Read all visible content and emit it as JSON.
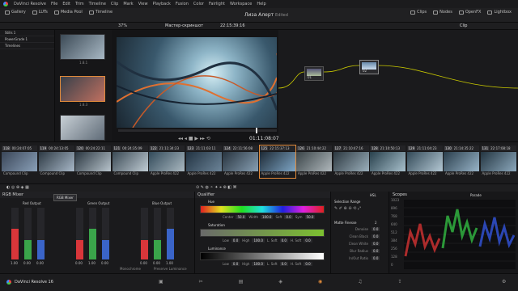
{
  "app": {
    "name": "DaVinci Resolve 16"
  },
  "menu": [
    "DaVinci Resolve",
    "File",
    "Edit",
    "Trim",
    "Timeline",
    "Clip",
    "Mark",
    "View",
    "Playback",
    "Fusion",
    "Color",
    "Fairlight",
    "Workspace",
    "Help"
  ],
  "toolbar": {
    "left": [
      {
        "label": "Gallery",
        "icon": "gallery-icon"
      },
      {
        "label": "LUTs",
        "icon": "luts-icon"
      },
      {
        "label": "Media Pool",
        "icon": "media-pool-icon"
      },
      {
        "label": "Timeline",
        "icon": "timeline-icon"
      }
    ],
    "project_title": "Лиза Алерт",
    "project_status": "Edited",
    "right": [
      {
        "label": "Clips",
        "icon": "clips-icon"
      },
      {
        "label": "Nodes",
        "icon": "nodes-icon"
      },
      {
        "label": "OpenFX",
        "icon": "openfx-icon"
      },
      {
        "label": "Lightbox",
        "icon": "lightbox-icon"
      }
    ]
  },
  "viewer": {
    "zoom": "37%",
    "timeline_name": "Мастер-скриншот",
    "timecode": "22:15:39:16",
    "playhead_tc": "01:11:08:07"
  },
  "nodes": {
    "mode": "Clip",
    "labels": [
      "01",
      "02"
    ]
  },
  "stills": [
    "Stills 1",
    "PowerGrade 1",
    "Timelines"
  ],
  "gallery": [
    "1.8.1",
    "1.8.3",
    "1.11.1"
  ],
  "clips": [
    {
      "num": "118",
      "tc": "00:24:07:05",
      "label": "Compound Clip",
      "c1": "#3a4658",
      "c2": "#8aa0b8"
    },
    {
      "num": "119",
      "tc": "00:24:13:05",
      "label": "Compound Clip",
      "c1": "#2e3a44",
      "c2": "#a8b8c8"
    },
    {
      "num": "120",
      "tc": "00:24:22:11",
      "label": "Compound Clip",
      "c1": "#2a3640",
      "c2": "#b8c4cc"
    },
    {
      "num": "121",
      "tc": "00:24:35:09",
      "label": "Compound Clip",
      "c1": "#3b4a55",
      "c2": "#c0ccd4"
    },
    {
      "num": "122",
      "tc": "21:11:34:23",
      "label": "Apple ProRes 422",
      "c1": "#324a5a",
      "c2": "#aab8c0"
    },
    {
      "num": "123",
      "tc": "21:11:03:11",
      "label": "Apple ProRes 422",
      "c1": "#223342",
      "c2": "#6c8498"
    },
    {
      "num": "124",
      "tc": "22:11:56:08",
      "label": "Apple ProRes 422",
      "c1": "#27333e",
      "c2": "#88a0b4"
    },
    {
      "num": "125",
      "tc": "22:15:37:13",
      "label": "Apple ProRes 422",
      "c1": "#1e2a35",
      "c2": "#7ea6c6",
      "active": true
    },
    {
      "num": "126",
      "tc": "21:10:44:22",
      "label": "Apple ProRes 422",
      "c1": "#3a4448",
      "c2": "#b0b8bc"
    },
    {
      "num": "127",
      "tc": "21:10:47:16",
      "label": "Apple ProRes 422",
      "c1": "#2c3840",
      "c2": "#9cb0bc"
    },
    {
      "num": "128",
      "tc": "21:10:50:13",
      "label": "Apple ProRes 422",
      "c1": "#28404c",
      "c2": "#a8c0cc"
    },
    {
      "num": "129",
      "tc": "21:11:04:23",
      "label": "Apple ProRes 422",
      "c1": "#334a58",
      "c2": "#b4c8d4"
    },
    {
      "num": "130",
      "tc": "21:14:35:22",
      "label": "Apple ProRes 422",
      "c1": "#2a3e4c",
      "c2": "#98b4c8"
    },
    {
      "num": "131",
      "tc": "22:17:08:18",
      "label": "Apple ProRes 422",
      "c1": "#243642",
      "c2": "#8ca8bc"
    }
  ],
  "tooltip": "RGB Mixer",
  "rgb_mixer": {
    "title": "RGB Mixer",
    "outputs": [
      {
        "label": "Red Output",
        "values": [
          "1.00",
          "0.00",
          "0.00"
        ],
        "levels": [
          0.6,
          0.38,
          0.38
        ]
      },
      {
        "label": "Green Output",
        "values": [
          "0.00",
          "1.00",
          "0.00"
        ],
        "levels": [
          0.38,
          0.6,
          0.38
        ]
      },
      {
        "label": "Blue Output",
        "values": [
          "0.00",
          "0.00",
          "1.00"
        ],
        "levels": [
          0.38,
          0.38,
          0.6
        ]
      }
    ],
    "monochrome": "Monochrome",
    "preserve": "Preserve Luminance"
  },
  "qualifier": {
    "title": "Qualifier",
    "sections": [
      {
        "label": "Hue",
        "fields": [
          {
            "k": "Center",
            "v": "50.0"
          },
          {
            "k": "Width",
            "v": "100.0"
          },
          {
            "k": "Soft",
            "v": "0.0"
          },
          {
            "k": "Sym",
            "v": "50.0"
          }
        ],
        "gradient": "linear-gradient(90deg,#e02020,#e0e020,#20e020,#20e0e0,#2020e0,#e020e0,#e02020)"
      },
      {
        "label": "Saturation",
        "fields": [
          {
            "k": "Low",
            "v": "0.0"
          },
          {
            "k": "High",
            "v": "100.0"
          },
          {
            "k": "L. Soft",
            "v": "0.0"
          },
          {
            "k": "H. Soft",
            "v": "0.0"
          }
        ],
        "gradient": "linear-gradient(90deg,#6a6a6a,#7cc030)"
      },
      {
        "label": "Luminance",
        "fields": [
          {
            "k": "Low",
            "v": "0.0"
          },
          {
            "k": "High",
            "v": "100.0"
          },
          {
            "k": "L. Soft",
            "v": "0.0"
          },
          {
            "k": "H. Soft",
            "v": "0.0"
          }
        ],
        "gradient": "linear-gradient(90deg,#000,#fff)"
      }
    ]
  },
  "selection": {
    "title": "Selection Range",
    "mode": "HSL",
    "matte_title": "Matte Finesse",
    "rows": [
      {
        "k": "Denoise",
        "v": "0.0"
      },
      {
        "k": "Clean Black",
        "v": "0.0"
      },
      {
        "k": "Clean White",
        "v": "0.0"
      },
      {
        "k": "Blur Radius",
        "v": "0.0"
      },
      {
        "k": "In/Out Ratio",
        "v": "0.0"
      }
    ],
    "pre_filter": "2"
  },
  "scopes": {
    "title": "Scopes",
    "mode": "Parade",
    "ticks": [
      "1023",
      "896",
      "768",
      "640",
      "512",
      "384",
      "256",
      "128",
      "0"
    ]
  },
  "colors": {
    "accent": "#e08a3a",
    "red": "#d8363a",
    "green": "#3aa44a",
    "blue": "#3a64c8"
  }
}
